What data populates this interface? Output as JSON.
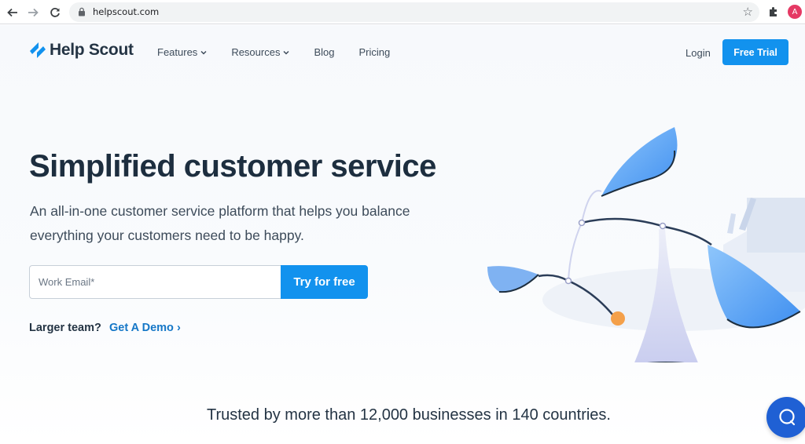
{
  "browser": {
    "url": "helpscout.com",
    "profile_initial": "A"
  },
  "header": {
    "logo_text": "Help Scout",
    "nav": [
      {
        "label": "Features",
        "has_dropdown": true
      },
      {
        "label": "Resources",
        "has_dropdown": true
      },
      {
        "label": "Blog",
        "has_dropdown": false
      },
      {
        "label": "Pricing",
        "has_dropdown": false
      }
    ],
    "login_label": "Login",
    "free_trial_label": "Free Trial"
  },
  "hero": {
    "title": "Simplified customer service",
    "subtitle": "An all-in-one customer service platform that helps you balance everything your customers need to be happy.",
    "email_placeholder": "Work Email*",
    "cta_label": "Try for free",
    "larger_team_text": "Larger team?",
    "demo_link": "Get A Demo ›"
  },
  "trusted_text": "Trusted by more than 12,000 businesses in 140 countries.",
  "colors": {
    "primary": "#1292ee",
    "link": "#1577c7",
    "heading": "#1d2e3f",
    "chat": "#1f60d4"
  },
  "icons": [
    "back-icon",
    "forward-icon",
    "reload-icon",
    "lock-icon",
    "star-icon",
    "extensions-icon",
    "chevron-down-icon",
    "chat-icon"
  ]
}
